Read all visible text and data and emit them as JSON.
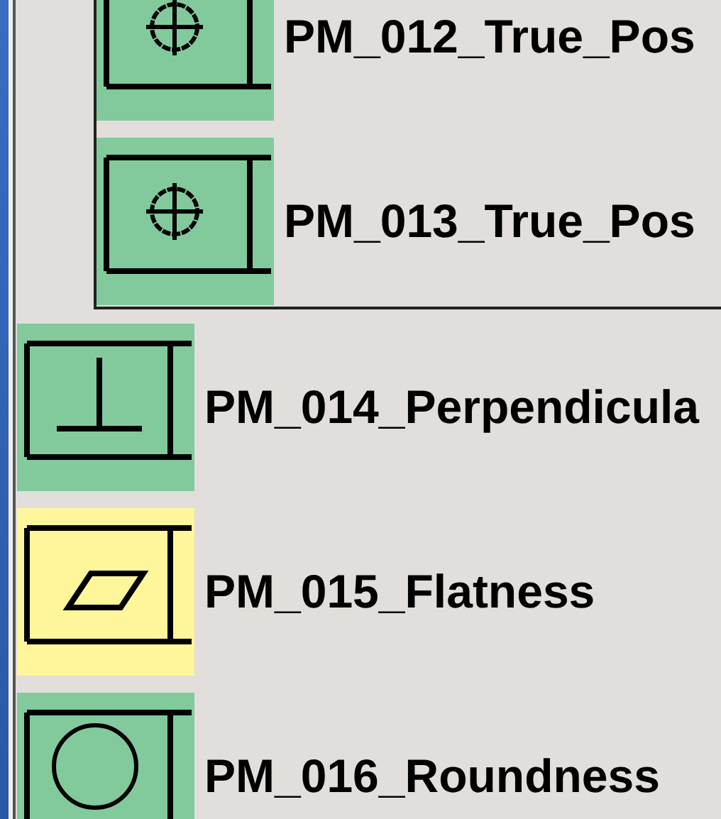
{
  "tree": [
    {
      "kind": "group",
      "children": [
        {
          "label": "PM_012_True_Pos",
          "kind": "position",
          "selected": false
        },
        {
          "label": "PM_013_True_Pos",
          "kind": "position",
          "selected": false
        }
      ]
    },
    {
      "kind": "perpendicularity",
      "label": "PM_014_Perpendicula",
      "selected": false
    },
    {
      "kind": "flatness",
      "label": "PM_015_Flatness",
      "selected": true
    },
    {
      "kind": "roundness",
      "label": "PM_016_Roundness",
      "selected": false
    }
  ]
}
